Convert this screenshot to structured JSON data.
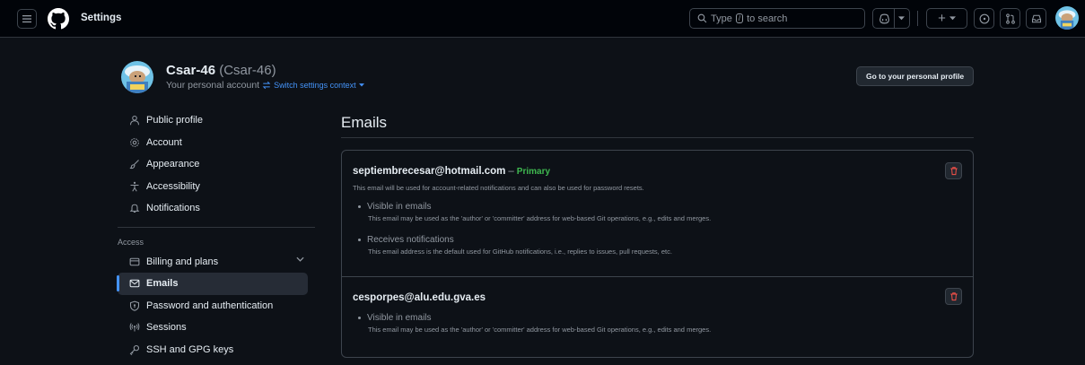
{
  "header": {
    "title": "Settings",
    "search_prefix": "Type",
    "search_key": "/",
    "search_suffix": "to search",
    "plus_label": "+"
  },
  "account": {
    "name": "Csar-46",
    "login": "(Csar-46)",
    "subtitle": "Your personal account",
    "switch_label": "Switch settings context",
    "profile_button": "Go to your personal profile"
  },
  "sidebar": {
    "items": [
      {
        "label": "Public profile",
        "icon": "person-icon"
      },
      {
        "label": "Account",
        "icon": "gear-icon"
      },
      {
        "label": "Appearance",
        "icon": "paintbrush-icon"
      },
      {
        "label": "Accessibility",
        "icon": "accessibility-icon"
      },
      {
        "label": "Notifications",
        "icon": "bell-icon"
      }
    ],
    "access_heading": "Access",
    "access_items": [
      {
        "label": "Billing and plans",
        "icon": "credit-card-icon"
      },
      {
        "label": "Emails",
        "icon": "mail-icon"
      },
      {
        "label": "Password and authentication",
        "icon": "shield-lock-icon"
      },
      {
        "label": "Sessions",
        "icon": "broadcast-icon"
      },
      {
        "label": "SSH and GPG keys",
        "icon": "key-icon"
      }
    ]
  },
  "main": {
    "title": "Emails",
    "emails": [
      {
        "address": "septiembrecesar@hotmail.com",
        "dash": "–",
        "badge": "Primary",
        "note": "This email will be used for account-related notifications and can also be used for password resets.",
        "bullets": [
          {
            "title": "Visible in emails",
            "desc": "This email may be used as the 'author' or 'committer' address for web-based Git operations, e.g., edits and merges."
          },
          {
            "title": "Receives notifications",
            "desc": "This email address is the default used for GitHub notifications, i.e., replies to issues, pull requests, etc."
          }
        ]
      },
      {
        "address": "cesporpes@alu.edu.gva.es",
        "bullets": [
          {
            "title": "Visible in emails",
            "desc": "This email may be used as the 'author' or 'committer' address for web-based Git operations, e.g., edits and merges."
          }
        ]
      }
    ]
  },
  "colors": {
    "accent": "#4493f8",
    "primary_badge": "#3fb950",
    "danger": "#f85149",
    "background": "#0d1117"
  }
}
